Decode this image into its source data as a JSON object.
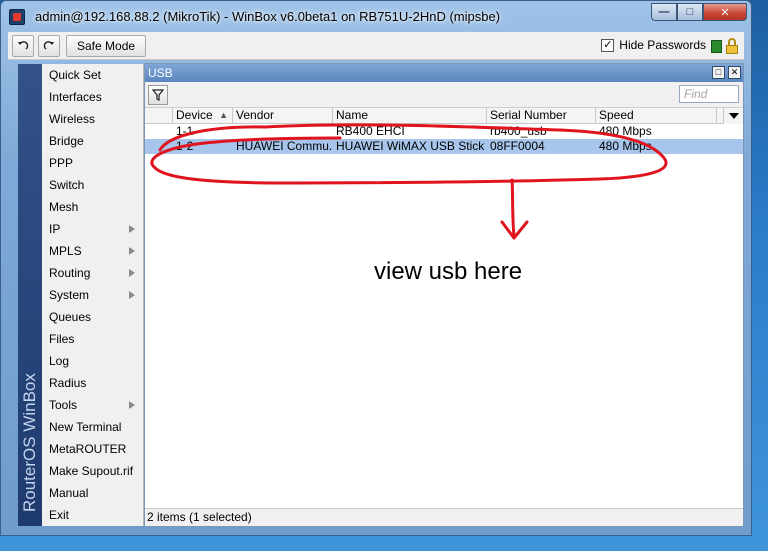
{
  "window": {
    "title": "admin@192.168.88.2 (MikroTik) - WinBox v6.0beta1 on RB751U-2HnD (mipsbe)"
  },
  "toolbar": {
    "undo_icon": "undo-icon",
    "redo_icon": "redo-icon",
    "safe_mode_label": "Safe Mode",
    "hide_passwords_label": "Hide Passwords",
    "hide_passwords_checked": true
  },
  "sidebar": {
    "brand": "RouterOS WinBox",
    "items": [
      {
        "label": "Quick Set",
        "submenu": false
      },
      {
        "label": "Interfaces",
        "submenu": false
      },
      {
        "label": "Wireless",
        "submenu": false
      },
      {
        "label": "Bridge",
        "submenu": false
      },
      {
        "label": "PPP",
        "submenu": false
      },
      {
        "label": "Switch",
        "submenu": false
      },
      {
        "label": "Mesh",
        "submenu": false
      },
      {
        "label": "IP",
        "submenu": true
      },
      {
        "label": "MPLS",
        "submenu": true
      },
      {
        "label": "Routing",
        "submenu": true
      },
      {
        "label": "System",
        "submenu": true
      },
      {
        "label": "Queues",
        "submenu": false
      },
      {
        "label": "Files",
        "submenu": false
      },
      {
        "label": "Log",
        "submenu": false
      },
      {
        "label": "Radius",
        "submenu": false
      },
      {
        "label": "Tools",
        "submenu": true
      },
      {
        "label": "New Terminal",
        "submenu": false
      },
      {
        "label": "MetaROUTER",
        "submenu": false
      },
      {
        "label": "Make Supout.rif",
        "submenu": false
      },
      {
        "label": "Manual",
        "submenu": false
      },
      {
        "label": "Exit",
        "submenu": false
      }
    ]
  },
  "usb_panel": {
    "title": "USB",
    "find_placeholder": "Find",
    "columns": [
      "Device",
      "Vendor",
      "Name",
      "Serial Number",
      "Speed"
    ],
    "rows": [
      {
        "device": "1-1",
        "vendor": "",
        "name": "RB400 EHCI",
        "serial": "rb400_usb",
        "speed": "480 Mbps",
        "selected": false
      },
      {
        "device": "1-2",
        "vendor": "HUAWEI Commu...",
        "name": "HUAWEI WiMAX USB Stick",
        "serial": "08FF0004",
        "speed": "480 Mbps",
        "selected": true
      }
    ],
    "status": "2 items (1 selected)"
  },
  "annotation": {
    "text": "view usb here",
    "color": "#e0141e"
  }
}
